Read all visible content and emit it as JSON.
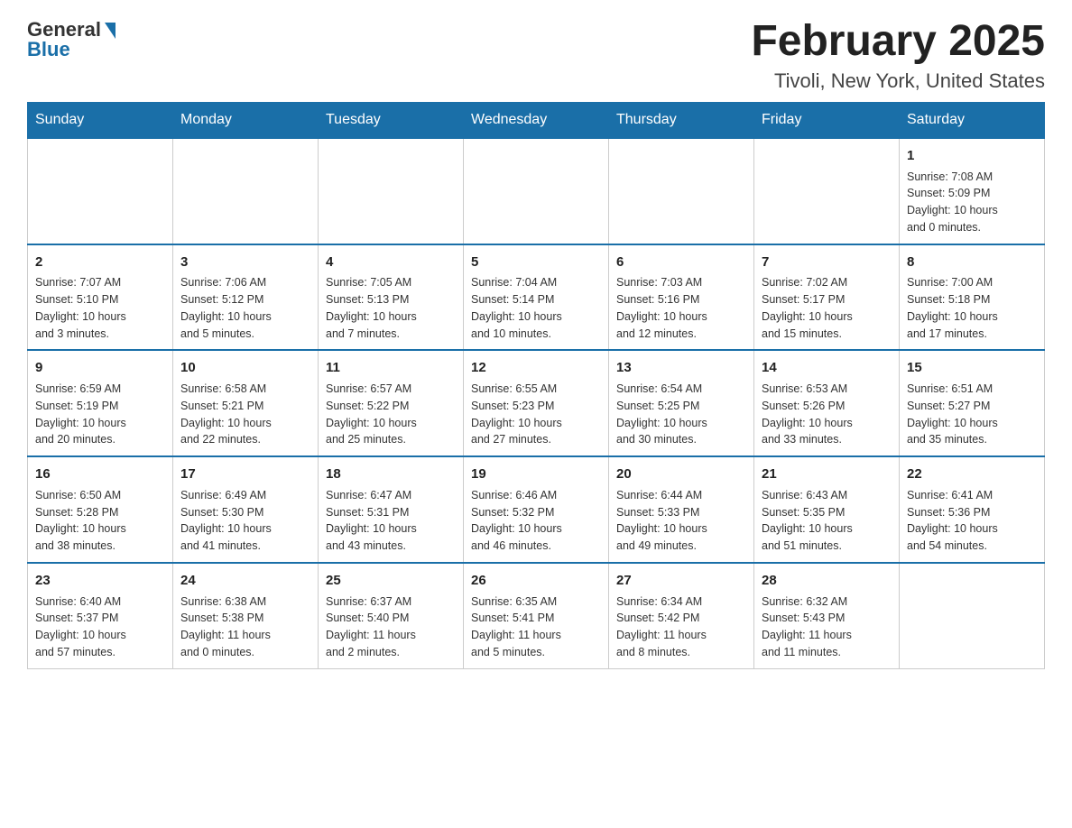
{
  "logo": {
    "general": "General",
    "blue": "Blue"
  },
  "title": "February 2025",
  "location": "Tivoli, New York, United States",
  "days_of_week": [
    "Sunday",
    "Monday",
    "Tuesday",
    "Wednesday",
    "Thursday",
    "Friday",
    "Saturday"
  ],
  "weeks": [
    [
      {
        "day": "",
        "info": ""
      },
      {
        "day": "",
        "info": ""
      },
      {
        "day": "",
        "info": ""
      },
      {
        "day": "",
        "info": ""
      },
      {
        "day": "",
        "info": ""
      },
      {
        "day": "",
        "info": ""
      },
      {
        "day": "1",
        "info": "Sunrise: 7:08 AM\nSunset: 5:09 PM\nDaylight: 10 hours\nand 0 minutes."
      }
    ],
    [
      {
        "day": "2",
        "info": "Sunrise: 7:07 AM\nSunset: 5:10 PM\nDaylight: 10 hours\nand 3 minutes."
      },
      {
        "day": "3",
        "info": "Sunrise: 7:06 AM\nSunset: 5:12 PM\nDaylight: 10 hours\nand 5 minutes."
      },
      {
        "day": "4",
        "info": "Sunrise: 7:05 AM\nSunset: 5:13 PM\nDaylight: 10 hours\nand 7 minutes."
      },
      {
        "day": "5",
        "info": "Sunrise: 7:04 AM\nSunset: 5:14 PM\nDaylight: 10 hours\nand 10 minutes."
      },
      {
        "day": "6",
        "info": "Sunrise: 7:03 AM\nSunset: 5:16 PM\nDaylight: 10 hours\nand 12 minutes."
      },
      {
        "day": "7",
        "info": "Sunrise: 7:02 AM\nSunset: 5:17 PM\nDaylight: 10 hours\nand 15 minutes."
      },
      {
        "day": "8",
        "info": "Sunrise: 7:00 AM\nSunset: 5:18 PM\nDaylight: 10 hours\nand 17 minutes."
      }
    ],
    [
      {
        "day": "9",
        "info": "Sunrise: 6:59 AM\nSunset: 5:19 PM\nDaylight: 10 hours\nand 20 minutes."
      },
      {
        "day": "10",
        "info": "Sunrise: 6:58 AM\nSunset: 5:21 PM\nDaylight: 10 hours\nand 22 minutes."
      },
      {
        "day": "11",
        "info": "Sunrise: 6:57 AM\nSunset: 5:22 PM\nDaylight: 10 hours\nand 25 minutes."
      },
      {
        "day": "12",
        "info": "Sunrise: 6:55 AM\nSunset: 5:23 PM\nDaylight: 10 hours\nand 27 minutes."
      },
      {
        "day": "13",
        "info": "Sunrise: 6:54 AM\nSunset: 5:25 PM\nDaylight: 10 hours\nand 30 minutes."
      },
      {
        "day": "14",
        "info": "Sunrise: 6:53 AM\nSunset: 5:26 PM\nDaylight: 10 hours\nand 33 minutes."
      },
      {
        "day": "15",
        "info": "Sunrise: 6:51 AM\nSunset: 5:27 PM\nDaylight: 10 hours\nand 35 minutes."
      }
    ],
    [
      {
        "day": "16",
        "info": "Sunrise: 6:50 AM\nSunset: 5:28 PM\nDaylight: 10 hours\nand 38 minutes."
      },
      {
        "day": "17",
        "info": "Sunrise: 6:49 AM\nSunset: 5:30 PM\nDaylight: 10 hours\nand 41 minutes."
      },
      {
        "day": "18",
        "info": "Sunrise: 6:47 AM\nSunset: 5:31 PM\nDaylight: 10 hours\nand 43 minutes."
      },
      {
        "day": "19",
        "info": "Sunrise: 6:46 AM\nSunset: 5:32 PM\nDaylight: 10 hours\nand 46 minutes."
      },
      {
        "day": "20",
        "info": "Sunrise: 6:44 AM\nSunset: 5:33 PM\nDaylight: 10 hours\nand 49 minutes."
      },
      {
        "day": "21",
        "info": "Sunrise: 6:43 AM\nSunset: 5:35 PM\nDaylight: 10 hours\nand 51 minutes."
      },
      {
        "day": "22",
        "info": "Sunrise: 6:41 AM\nSunset: 5:36 PM\nDaylight: 10 hours\nand 54 minutes."
      }
    ],
    [
      {
        "day": "23",
        "info": "Sunrise: 6:40 AM\nSunset: 5:37 PM\nDaylight: 10 hours\nand 57 minutes."
      },
      {
        "day": "24",
        "info": "Sunrise: 6:38 AM\nSunset: 5:38 PM\nDaylight: 11 hours\nand 0 minutes."
      },
      {
        "day": "25",
        "info": "Sunrise: 6:37 AM\nSunset: 5:40 PM\nDaylight: 11 hours\nand 2 minutes."
      },
      {
        "day": "26",
        "info": "Sunrise: 6:35 AM\nSunset: 5:41 PM\nDaylight: 11 hours\nand 5 minutes."
      },
      {
        "day": "27",
        "info": "Sunrise: 6:34 AM\nSunset: 5:42 PM\nDaylight: 11 hours\nand 8 minutes."
      },
      {
        "day": "28",
        "info": "Sunrise: 6:32 AM\nSunset: 5:43 PM\nDaylight: 11 hours\nand 11 minutes."
      },
      {
        "day": "",
        "info": ""
      }
    ]
  ]
}
